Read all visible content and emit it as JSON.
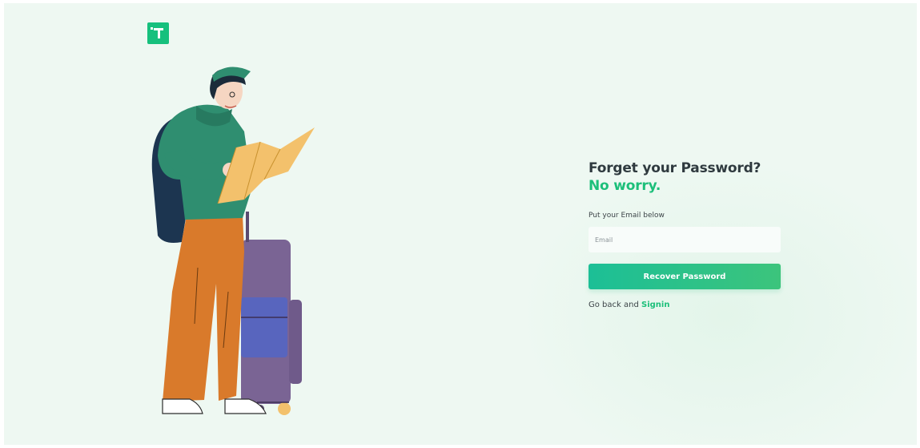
{
  "brand": {
    "logo_letter": "T",
    "color": "#16c07d"
  },
  "form": {
    "title": "Forget your Password?",
    "subtitle": "No worry.",
    "email_label": "Put your Email below",
    "email_placeholder": "Email",
    "email_value": "",
    "submit_label": "Recover Password",
    "back_text": "Go back and",
    "back_link": "Signin"
  },
  "colors": {
    "accent": "#1cbf7a",
    "background": "#eef8f2",
    "text": "#2f3a3f"
  },
  "illustration": {
    "description_icon": "traveler-with-map-and-suitcase-illustration"
  }
}
